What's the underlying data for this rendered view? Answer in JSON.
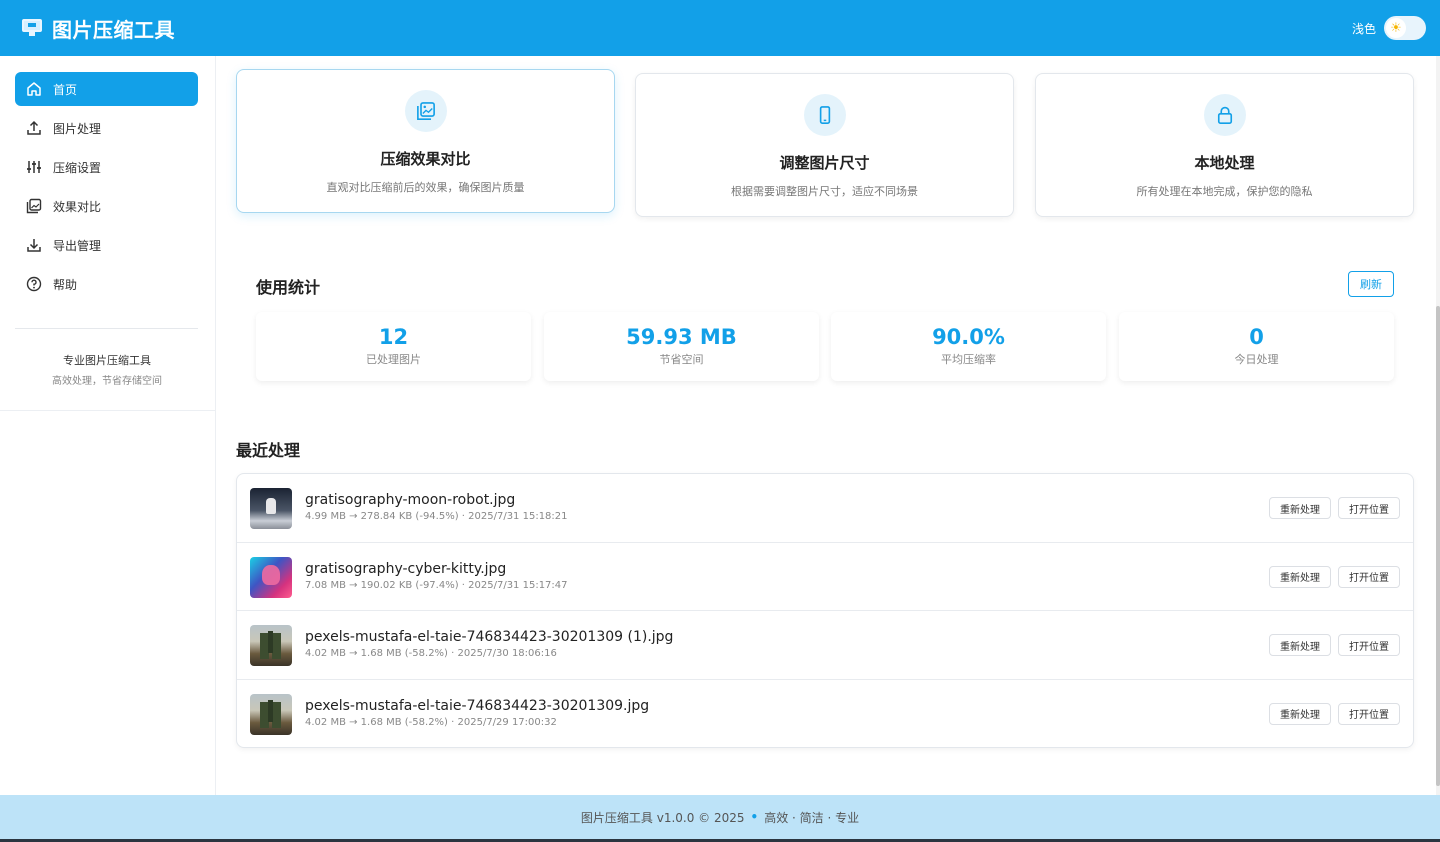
{
  "header": {
    "title": "图片压缩工具",
    "theme_label": "浅色",
    "theme_icon": "sun-icon",
    "accent_color": "#12a0e8"
  },
  "sidebar": {
    "items": [
      {
        "label": "首页",
        "icon": "home-icon",
        "active": true
      },
      {
        "label": "图片处理",
        "icon": "upload-icon",
        "active": false
      },
      {
        "label": "压缩设置",
        "icon": "sliders-icon",
        "active": false
      },
      {
        "label": "效果对比",
        "icon": "image-compare-icon",
        "active": false
      },
      {
        "label": "导出管理",
        "icon": "download-icon",
        "active": false
      },
      {
        "label": "帮助",
        "icon": "help-circle-icon",
        "active": false
      }
    ],
    "brand_title": "专业图片压缩工具",
    "brand_subtitle": "高效处理，节省存储空间"
  },
  "features": [
    {
      "title": "压缩效果对比",
      "desc": "直观对比压缩前后的效果，确保图片质量",
      "icon": "image-compare-icon"
    },
    {
      "title": "调整图片尺寸",
      "desc": "根据需要调整图片尺寸，适应不同场景",
      "icon": "phone-icon"
    },
    {
      "title": "本地处理",
      "desc": "所有处理在本地完成，保护您的隐私",
      "icon": "lock-icon"
    }
  ],
  "stats": {
    "title": "使用统计",
    "refresh_label": "刷新",
    "items": [
      {
        "value": "12",
        "label": "已处理图片"
      },
      {
        "value": "59.93 MB",
        "label": "节省空间"
      },
      {
        "value": "90.0%",
        "label": "平均压缩率"
      },
      {
        "value": "0",
        "label": "今日处理"
      }
    ]
  },
  "recent": {
    "title": "最近处理",
    "reprocess_label": "重新处理",
    "open_location_label": "打开位置",
    "items": [
      {
        "name": "gratisography-moon-robot.jpg",
        "meta": "4.99 MB → 278.84 KB (-94.5%) · 2025/7/31 15:18:21"
      },
      {
        "name": "gratisography-cyber-kitty.jpg",
        "meta": "7.08 MB → 190.02 KB (-97.4%) · 2025/7/31 15:17:47"
      },
      {
        "name": "pexels-mustafa-el-taie-746834423-30201309 (1).jpg",
        "meta": "4.02 MB → 1.68 MB (-58.2%) · 2025/7/30 18:06:16"
      },
      {
        "name": "pexels-mustafa-el-taie-746834423-30201309.jpg",
        "meta": "4.02 MB → 1.68 MB (-58.2%) · 2025/7/29 17:00:32"
      }
    ]
  },
  "footer": {
    "left": "图片压缩工具 v1.0.0 © 2025",
    "right": "高效 · 简洁 · 专业"
  }
}
